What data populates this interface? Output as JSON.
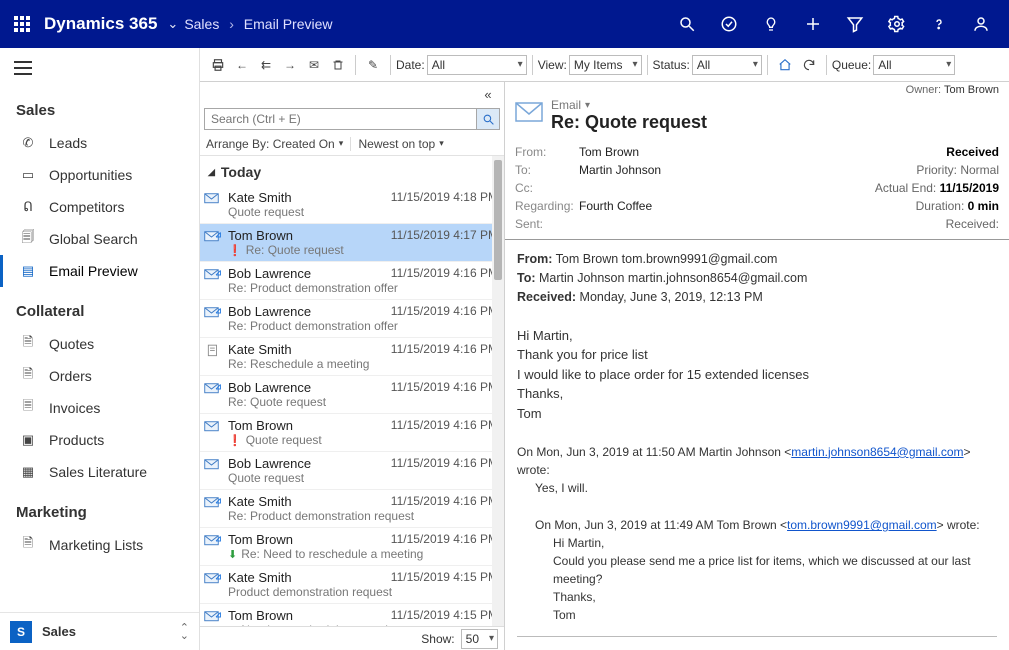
{
  "topbar": {
    "brand": "Dynamics 365",
    "crumb1": "Sales",
    "crumb2": "Email Preview"
  },
  "nav": {
    "group1": "Sales",
    "items1": [
      "Leads",
      "Opportunities",
      "Competitors",
      "Global Search",
      "Email Preview"
    ],
    "group2": "Collateral",
    "items2": [
      "Quotes",
      "Orders",
      "Invoices",
      "Products",
      "Sales Literature"
    ],
    "group3": "Marketing",
    "items3": [
      "Marketing Lists"
    ],
    "area_letter": "S",
    "area_label": "Sales"
  },
  "toolbar": {
    "date_label": "Date:",
    "date_value": "All",
    "view_label": "View:",
    "view_value": "My Items",
    "status_label": "Status:",
    "status_value": "All",
    "queue_label": "Queue:",
    "queue_value": "All"
  },
  "listpane": {
    "search_placeholder": "Search (Ctrl + E)",
    "arrange_label": "Arrange By: Created On",
    "sort_label": "Newest on top",
    "group": "Today",
    "show_label": "Show:",
    "show_value": "50",
    "items": [
      {
        "from": "Kate Smith",
        "date": "11/15/2019 4:18 PM",
        "subj": "Quote request",
        "flag": "none",
        "dir": "in"
      },
      {
        "from": "Tom Brown",
        "date": "11/15/2019 4:17 PM",
        "subj": "Re: Quote request",
        "flag": "red",
        "dir": "out",
        "selected": true
      },
      {
        "from": "Bob Lawrence",
        "date": "11/15/2019 4:16 PM",
        "subj": "Re: Product demonstration offer",
        "flag": "none",
        "dir": "out"
      },
      {
        "from": "Bob Lawrence",
        "date": "11/15/2019 4:16 PM",
        "subj": "Re: Product demonstration offer",
        "flag": "none",
        "dir": "out"
      },
      {
        "from": "Kate Smith",
        "date": "11/15/2019 4:16 PM",
        "subj": "Re: Reschedule a meeting",
        "flag": "none",
        "dir": "doc"
      },
      {
        "from": "Bob Lawrence",
        "date": "11/15/2019 4:16 PM",
        "subj": "Re: Quote request",
        "flag": "none",
        "dir": "out"
      },
      {
        "from": "Tom Brown",
        "date": "11/15/2019 4:16 PM",
        "subj": "Quote request",
        "flag": "red",
        "dir": "in"
      },
      {
        "from": "Bob Lawrence",
        "date": "11/15/2019 4:16 PM",
        "subj": "Quote request",
        "flag": "none",
        "dir": "in"
      },
      {
        "from": "Kate Smith",
        "date": "11/15/2019 4:16 PM",
        "subj": "Re: Product demonstration request",
        "flag": "none",
        "dir": "out"
      },
      {
        "from": "Tom Brown",
        "date": "11/15/2019 4:16 PM",
        "subj": "Re: Need to reschedule a meeting",
        "flag": "green",
        "dir": "out"
      },
      {
        "from": "Kate Smith",
        "date": "11/15/2019 4:15 PM",
        "subj": "Product demonstration request",
        "flag": "none",
        "dir": "out"
      },
      {
        "from": "Tom Brown",
        "date": "11/15/2019 4:15 PM",
        "subj": "Need to reschedule a meeting",
        "flag": "green",
        "dir": "out"
      }
    ]
  },
  "reading": {
    "owner_label": "Owner:",
    "owner_value": "Tom Brown",
    "kind": "Email",
    "subject": "Re: Quote request",
    "fields": {
      "from": "Tom Brown",
      "to": "Martin Johnson",
      "cc": "",
      "regarding": "Fourth Coffee",
      "sent": "",
      "status": "Received",
      "priority_label": "Priority:",
      "priority_value": "Normal",
      "actualend_label": "Actual End:",
      "actualend_value": "11/15/2019",
      "duration_label": "Duration:",
      "duration_value": "0 min",
      "received_label": "Received:"
    },
    "labels": {
      "from": "From:",
      "to": "To:",
      "cc": "Cc:",
      "regarding": "Regarding:",
      "sent": "Sent:"
    },
    "body": {
      "h_from": "From:",
      "h_from_v": "Tom Brown tom.brown9991@gmail.com",
      "h_to": "To:",
      "h_to_v": "Martin Johnson martin.johnson8654@gmail.com",
      "h_recv": "Received:",
      "h_recv_v": "Monday, June 3, 2019, 12:13 PM",
      "p1": "Hi Martin,",
      "p2": "Thank you for price list",
      "p3": "I would like to place order for 15 extended licenses",
      "p4": "Thanks,",
      "p5": "Tom",
      "q1_intro_a": "On Mon, Jun 3, 2019 at 11:50 AM Martin Johnson <",
      "q1_email": "martin.johnson8654@gmail.com",
      "q1_intro_b": "> wrote:",
      "q1_body": "Yes, I will.",
      "q2_intro_a": "On Mon, Jun 3, 2019 at 11:49 AM Tom Brown <",
      "q2_email": "tom.brown9991@gmail.com",
      "q2_intro_b": ">  wrote:",
      "q2_l1": "Hi Martin,",
      "q2_l2": "Could you please send me a price list for items, which we discussed at our last meeting?",
      "q2_l3": "Thanks,",
      "q2_l4": "Tom"
    }
  }
}
